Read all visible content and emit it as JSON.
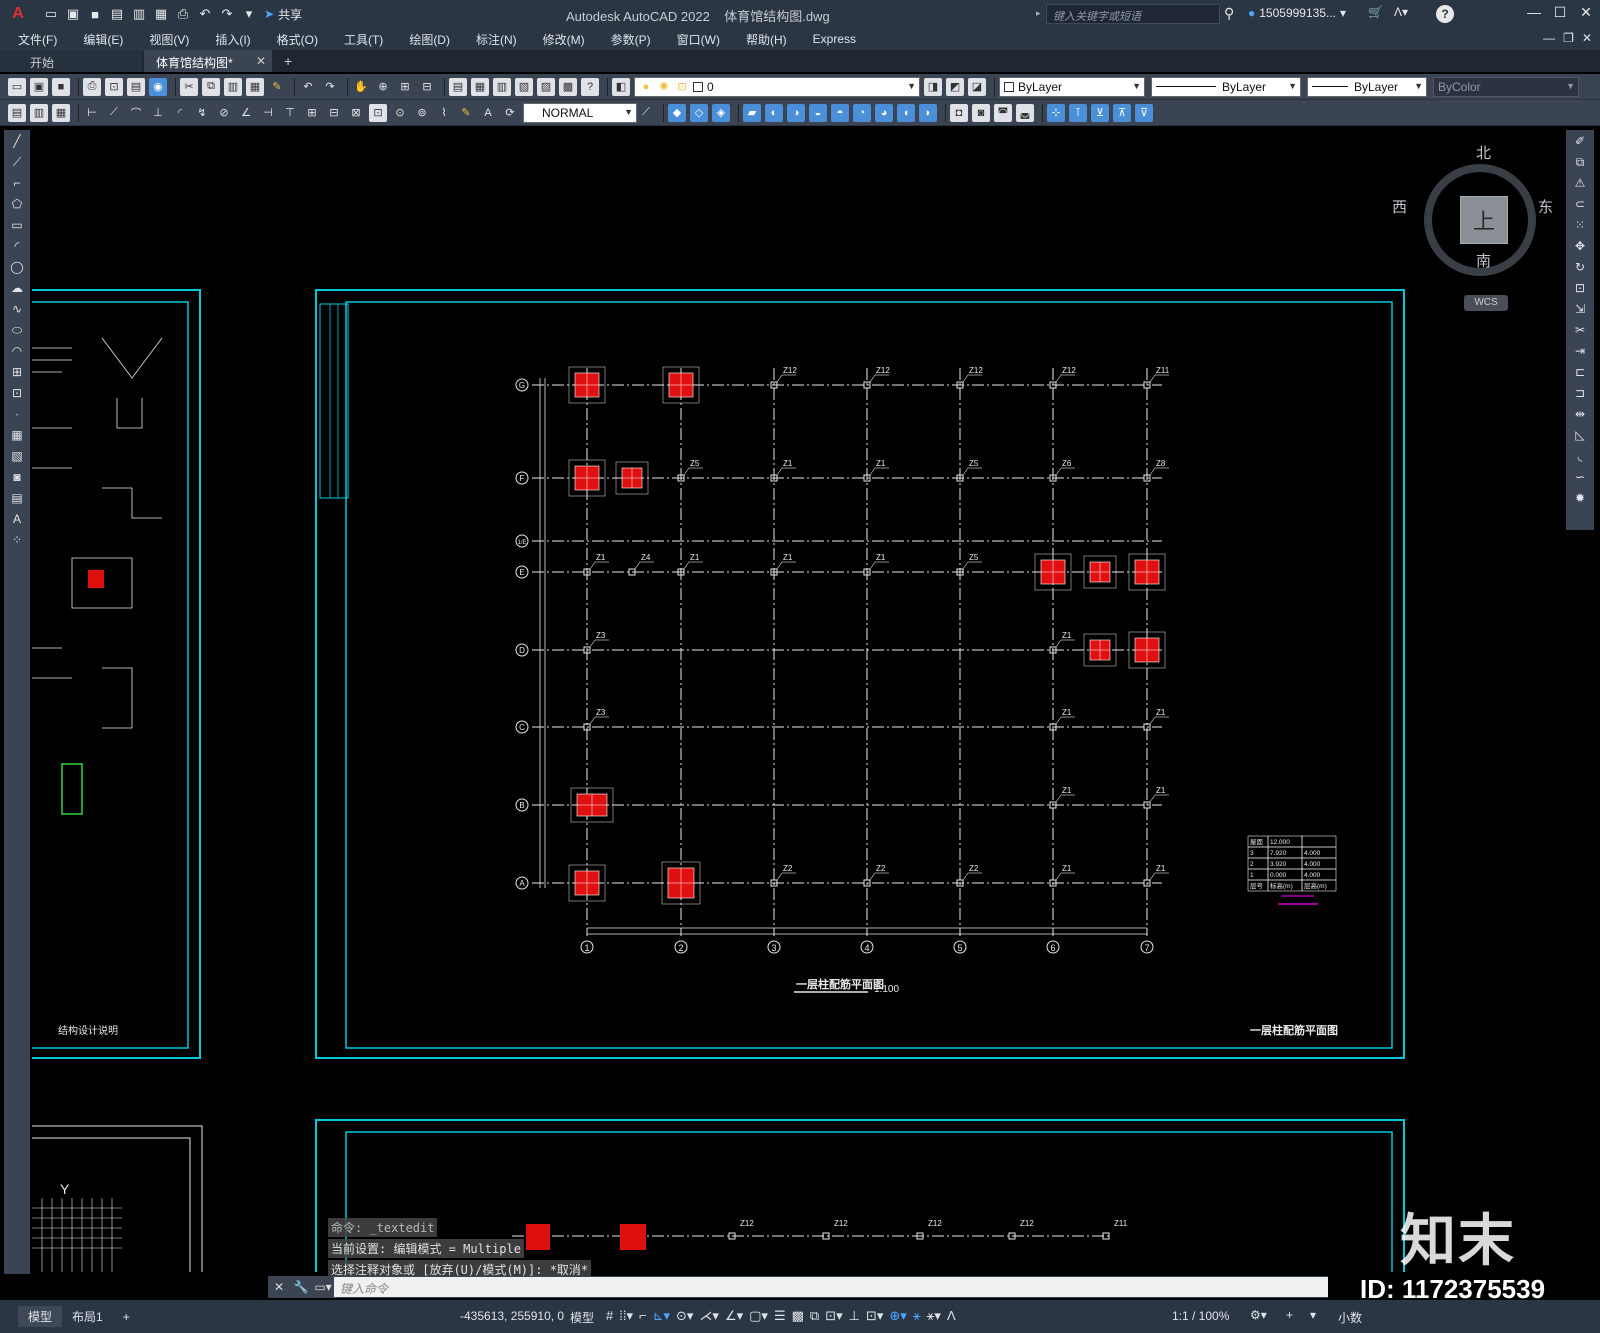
{
  "app": {
    "title": "Autodesk AutoCAD 2022",
    "file_name": "体育馆结构图.dwg",
    "share_label": "共享",
    "search_placeholder": "键入关键字或短语",
    "user": "1505999135...",
    "logo_letter": "A"
  },
  "menu": [
    "文件(F)",
    "编辑(E)",
    "视图(V)",
    "插入(I)",
    "格式(O)",
    "工具(T)",
    "绘图(D)",
    "标注(N)",
    "修改(M)",
    "参数(P)",
    "窗口(W)",
    "帮助(H)",
    "Express"
  ],
  "tabs": {
    "start": "开始",
    "active": "体育馆结构图*",
    "close": "✕",
    "add": "+"
  },
  "toolbar1": {
    "layer_value": "0",
    "color_value": "ByLayer",
    "linetype_value": "ByLayer",
    "lineweight_value": "ByLayer",
    "plotstyle_value": "ByColor"
  },
  "toolbar2": {
    "style_value": "NORMAL"
  },
  "viewcube": {
    "north": "北",
    "south": "南",
    "east": "东",
    "west": "西",
    "face": "上",
    "wcs": "WCS"
  },
  "drawing": {
    "main_title": "一层柱配筋平面图",
    "main_scale": "1:100",
    "sheet_title": "一层柱配筋平面图",
    "left_sheet_title": "结构设计说明",
    "axes_x": [
      "1",
      "2",
      "3",
      "4",
      "5",
      "6",
      "7"
    ],
    "axes_y": [
      "G",
      "F",
      "1/E",
      "E",
      "D",
      "C",
      "B",
      "A"
    ],
    "col_labels": [
      {
        "axis": "G",
        "labels": [
          "Z12",
          "Z12",
          "Z12",
          "Z12",
          "Z11"
        ]
      },
      {
        "axis": "F",
        "labels": [
          "Z5",
          "Z1",
          "Z1",
          "Z5",
          "Z6",
          "Z8"
        ]
      },
      {
        "axis": "E",
        "labels": [
          "Z1",
          "Z4",
          "Z1",
          "Z1",
          "Z1",
          "Z5"
        ]
      },
      {
        "axis": "D",
        "labels": [
          "Z3",
          "Z1"
        ]
      },
      {
        "axis": "C",
        "labels": [
          "Z3",
          "Z1",
          "Z1"
        ]
      },
      {
        "axis": "B",
        "labels": [
          "Z1",
          "Z1"
        ]
      },
      {
        "axis": "A",
        "labels": [
          "Z2",
          "Z2",
          "Z2",
          "Z1",
          "Z1"
        ]
      }
    ],
    "floor_table": {
      "rows": [
        [
          "屋面",
          "12.000",
          ""
        ],
        [
          "3",
          "7.920",
          "4.000"
        ],
        [
          "2",
          "3.920",
          "4.000"
        ],
        [
          "1",
          "0.000",
          "4.000"
        ],
        [
          "层号",
          "标高(m)",
          "层高(m)"
        ]
      ]
    },
    "bottom_labels": [
      "Z12",
      "Z12",
      "Z12",
      "Z12",
      "Z11"
    ],
    "left_y_label": "Y"
  },
  "command": {
    "history": [
      "命令: _textedit",
      "当前设置: 编辑模式 = Multiple",
      "选择注释对象或 [放弃(U)/模式(M)]: *取消*"
    ],
    "placeholder": "键入命令"
  },
  "status": {
    "tab_model": "模型",
    "tab_layout": "布局1",
    "coords": "-435613, 255910, 0",
    "mode": "模型",
    "scale": "1:1 / 100%",
    "units": "小数"
  },
  "watermark": {
    "brand": "知末",
    "id": "ID: 1172375539"
  },
  "colors": {
    "cyan": "#00c8d8",
    "red": "#e01010",
    "magenta": "#ff00ff",
    "grid": "#e8e8e8"
  }
}
